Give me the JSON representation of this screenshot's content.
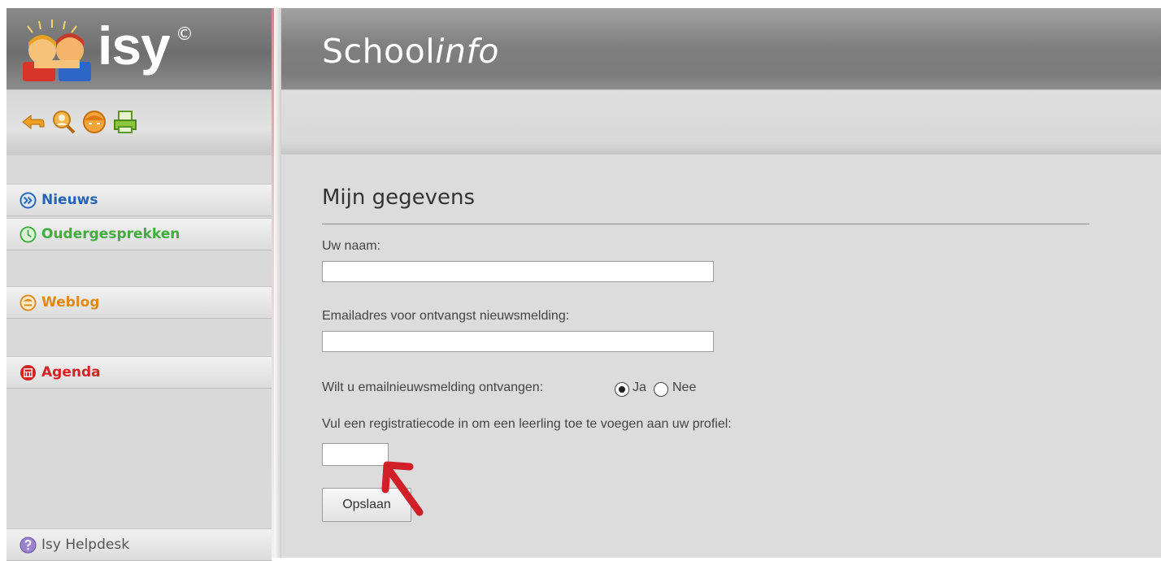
{
  "logo": {
    "text": "isy",
    "copyright": "©"
  },
  "header": {
    "title_plain": "School",
    "title_italic": "info"
  },
  "toolbar": {
    "icons": [
      "logout-icon",
      "search-user-icon",
      "face-icon",
      "print-icon"
    ]
  },
  "sidebar": {
    "items": [
      {
        "label": "Nieuws",
        "icon": "arrow-circle-icon",
        "color": "#2563b8"
      },
      {
        "label": "Oudergesprekken",
        "icon": "clock-icon",
        "color": "#3fae3c"
      },
      {
        "label": "Weblog",
        "icon": "weblog-icon",
        "color": "#e08a15"
      },
      {
        "label": "Agenda",
        "icon": "calendar-icon",
        "color": "#d62222"
      }
    ],
    "helpdesk": {
      "label": "Isy Helpdesk",
      "icon": "question-icon",
      "color": "#7b5fb0"
    }
  },
  "form": {
    "title": "Mijn gegevens",
    "name_label": "Uw naam:",
    "name_value": "",
    "email_label": "Emailadres voor ontvangst nieuwsmelding:",
    "email_value": "",
    "notify_label": "Wilt u emailnieuwsmelding ontvangen:",
    "notify_options": [
      "Ja",
      "Nee"
    ],
    "notify_selected": "Ja",
    "code_label": "Vul een registratiecode in om een leerling toe te voegen aan uw profiel:",
    "code_value": "",
    "save_label": "Opslaan"
  },
  "annotation": {
    "arrow_color": "#d01f26"
  }
}
